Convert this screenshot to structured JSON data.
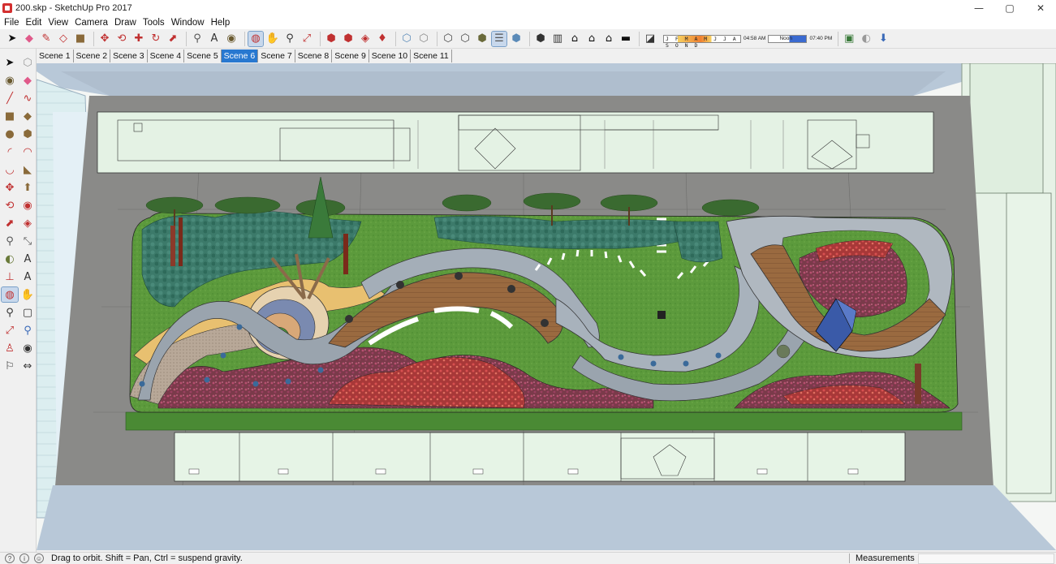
{
  "window": {
    "title": "200.skp - SketchUp Pro 2017",
    "controls": [
      "minimize",
      "maximize",
      "close"
    ]
  },
  "menu": [
    "File",
    "Edit",
    "View",
    "Camera",
    "Draw",
    "Tools",
    "Window",
    "Help"
  ],
  "toolbar": {
    "icons": [
      "select-icon",
      "eraser-icon",
      "pencil-icon",
      "shapes-icon",
      "push-pull-icon",
      "move-icon",
      "rotate-icon",
      "scale-icon",
      "tape-measure-icon",
      "text-icon",
      "paint-bucket-icon",
      "orbit-icon",
      "pan-icon",
      "zoom-icon",
      "zoom-extents-icon",
      "warehouse-icon",
      "extension-icon",
      "layout-icon",
      "ruby-icon",
      "xray-icon",
      "back-edges-icon",
      "wireframe-icon",
      "hidden-line-icon",
      "shaded-icon",
      "textured-icon",
      "monochrome-icon",
      "iso-view-icon",
      "top-view-icon",
      "front-view-icon",
      "right-view-icon",
      "back-view-icon",
      "left-view-icon",
      "shadows-icon"
    ],
    "shadow_months": "J F M A M J J A S O N D",
    "shadow_time_start": "04:58 AM",
    "shadow_time_noon": "Noon",
    "shadow_time_end": "07:40 PM",
    "extra_icons": [
      "geo-location-icon",
      "fog-icon",
      "export-icon"
    ]
  },
  "scenes": {
    "tabs": [
      "Scene 1",
      "Scene 2",
      "Scene 3",
      "Scene 4",
      "Scene 5",
      "Scene 6",
      "Scene 7",
      "Scene 8",
      "Scene 9",
      "Scene 10",
      "Scene 11"
    ],
    "selected": "Scene 6"
  },
  "large_tools": [
    "select-tool-icon",
    "component-icon",
    "paint-icon",
    "eraser-icon",
    "line-icon",
    "freehand-icon",
    "rectangle-icon",
    "rotated-rect-icon",
    "circle-icon",
    "polygon-icon",
    "arc-icon",
    "pie-icon",
    "two-point-arc-icon",
    "three-point-arc-icon",
    "move-icon",
    "push-pull-icon",
    "rotate-icon",
    "follow-me-icon",
    "scale-icon",
    "offset-icon",
    "tape-measure-icon",
    "dimension-icon",
    "protractor-icon",
    "text-icon",
    "axes-icon",
    "3d-text-icon",
    "orbit-icon",
    "pan-icon",
    "zoom-icon",
    "zoom-window-icon",
    "zoom-extents-icon",
    "previous-icon",
    "position-camera-icon",
    "look-around-icon",
    "walk-icon",
    "section-plane-icon"
  ],
  "status": {
    "hint": "Drag to orbit. Shift = Pan, Ctrl = suspend gravity.",
    "measurements_label": "Measurements",
    "measurements_value": ""
  },
  "colors": {
    "grass": "#5a9a3a",
    "paving": "#8a8a8a",
    "deck": "#9a6a40",
    "building_tint": "#e6f2e6",
    "selected_tab": "#2878d0"
  }
}
